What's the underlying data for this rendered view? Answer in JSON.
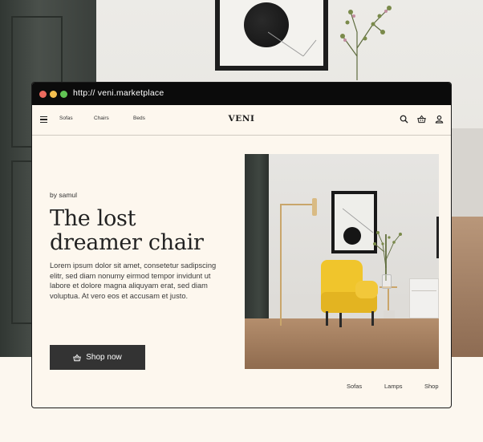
{
  "browser": {
    "url": "http:// veni.marketplace",
    "window_controls": [
      "close",
      "minimize",
      "maximize"
    ]
  },
  "nav": {
    "menu_icon": "hamburger-menu-icon",
    "links": [
      "Sofas",
      "Chairs",
      "Beds"
    ],
    "brand": "VENI",
    "icons": [
      "search-icon",
      "basket-icon",
      "user-icon"
    ]
  },
  "hero": {
    "byline": "by samul",
    "title_line1": "The lost",
    "title_line2": "dreamer chair",
    "body": "Lorem ipsum dolor sit amet, consetetur sadipscing elitr, sed diam nonumy eirmod tempor invidunt ut labore et dolore magna aliquyam erat, sed diam voluptua. At vero eos et accusam et justo.",
    "cta_label": "Shop now",
    "cta_icon": "basket-icon"
  },
  "footer": {
    "links": [
      "Sofas",
      "Lamps",
      "Shop"
    ]
  },
  "colors": {
    "page_bg": "#fcf7ef",
    "titlebar": "#0b0b0b",
    "button_bg": "#333333",
    "accent_yellow": "#f0c52c"
  }
}
